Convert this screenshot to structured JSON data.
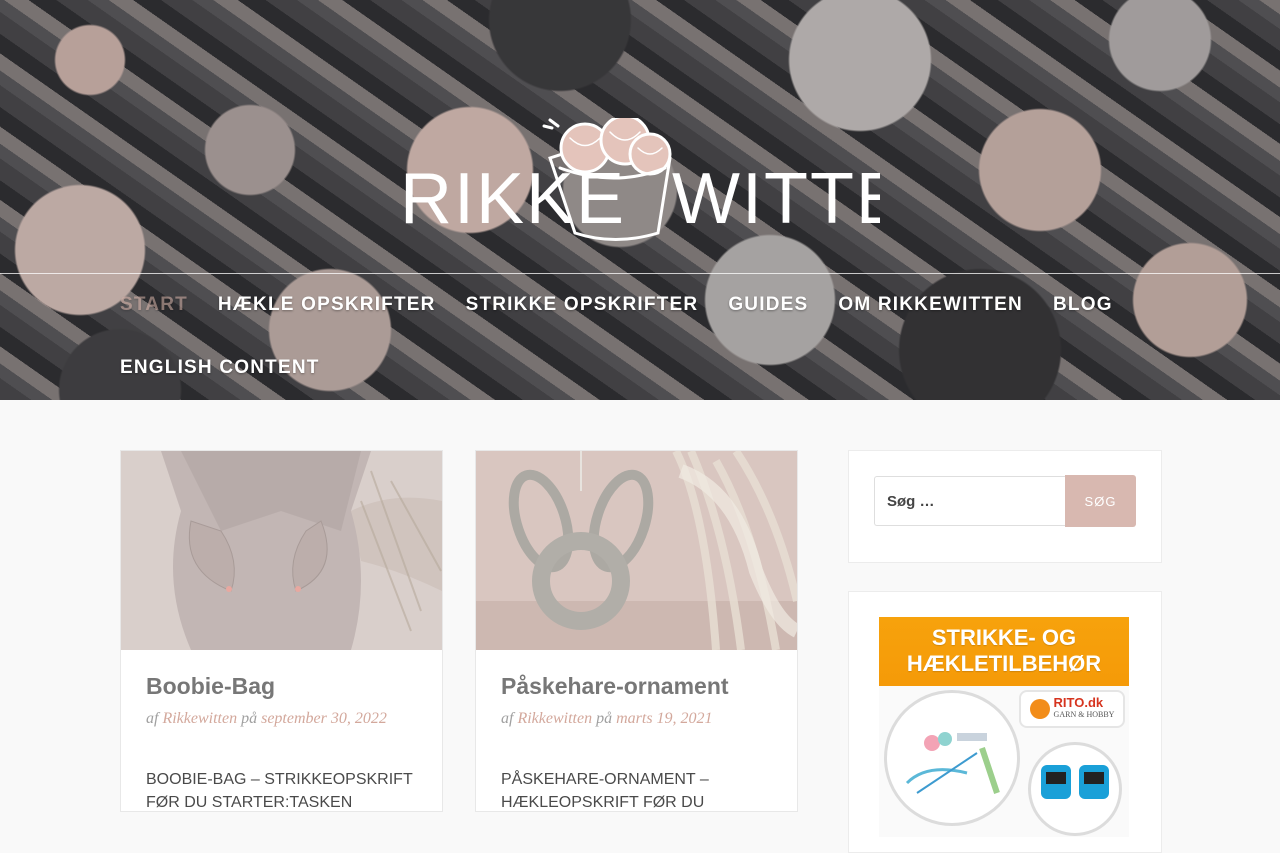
{
  "site": {
    "logo_left": "RIKKE",
    "logo_right": "WITTEN"
  },
  "nav": {
    "items": [
      {
        "label": "START",
        "active": true
      },
      {
        "label": "HÆKLE OPSKRIFTER"
      },
      {
        "label": "STRIKKE OPSKRIFTER"
      },
      {
        "label": "GUIDES"
      },
      {
        "label": "OM RIKKEWITTEN"
      },
      {
        "label": "BLOG"
      },
      {
        "label": "ENGLISH CONTENT"
      }
    ]
  },
  "posts": [
    {
      "title": "Boobie-Bag",
      "meta_by": "af",
      "author": "Rikkewitten",
      "meta_on": "på",
      "date": "september 30, 2022",
      "excerpt": "BOOBIE-BAG – STRIKKEOPSKRIFT FØR DU STARTER:Tasken strikkes primært"
    },
    {
      "title": "Påskehare-ornament",
      "meta_by": "af",
      "author": "Rikkewitten",
      "meta_on": "på",
      "date": "marts 19, 2021",
      "excerpt": "PÅSKEHARE-ORNAMENT – HÆKLEOPSKRIFT FØR DU"
    }
  ],
  "sidebar": {
    "search": {
      "placeholder": "Søg …",
      "button": "SØG"
    },
    "ad": {
      "line1": "STRIKKE- OG",
      "line2": "HÆKLETILBEHØR",
      "brand": "RITO.dk",
      "brand_sub": "GARN & HOBBY"
    }
  },
  "colors": {
    "accent": "#d8b8b0",
    "link": "#d3a89c",
    "ad_orange": "#f7a20c"
  }
}
